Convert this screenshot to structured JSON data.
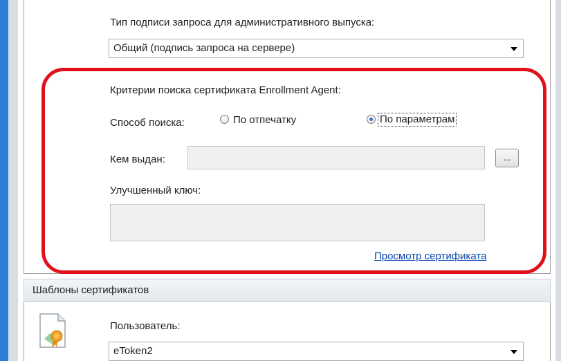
{
  "admin_release": {
    "signature_type_label": "Тип подписи запроса для административного выпуска:",
    "signature_type_value": "Общий (подпись запроса на сервере)"
  },
  "enrollment_agent": {
    "criteria_label": "Критерии поиска сертификата Enrollment Agent:",
    "search_method_label": "Способ поиска:",
    "option_thumbprint": "По отпечатку",
    "option_parameters": "По параметрам",
    "selected_option": "option_parameters",
    "issued_by_label": "Кем выдан:",
    "issued_by_value": "",
    "browse_button_label": "...",
    "enhanced_key_label": "Улучшенный ключ:",
    "enhanced_key_value": "",
    "view_certificate_link": "Просмотр сертификата"
  },
  "templates": {
    "header": "Шаблоны сертификатов",
    "user_label": "Пользователь:",
    "user_value": "eToken2",
    "icon": "certificate-icon"
  },
  "colors": {
    "highlight": "#e0111b",
    "link": "#0645ad",
    "window_accent": "#2b7fd6"
  }
}
